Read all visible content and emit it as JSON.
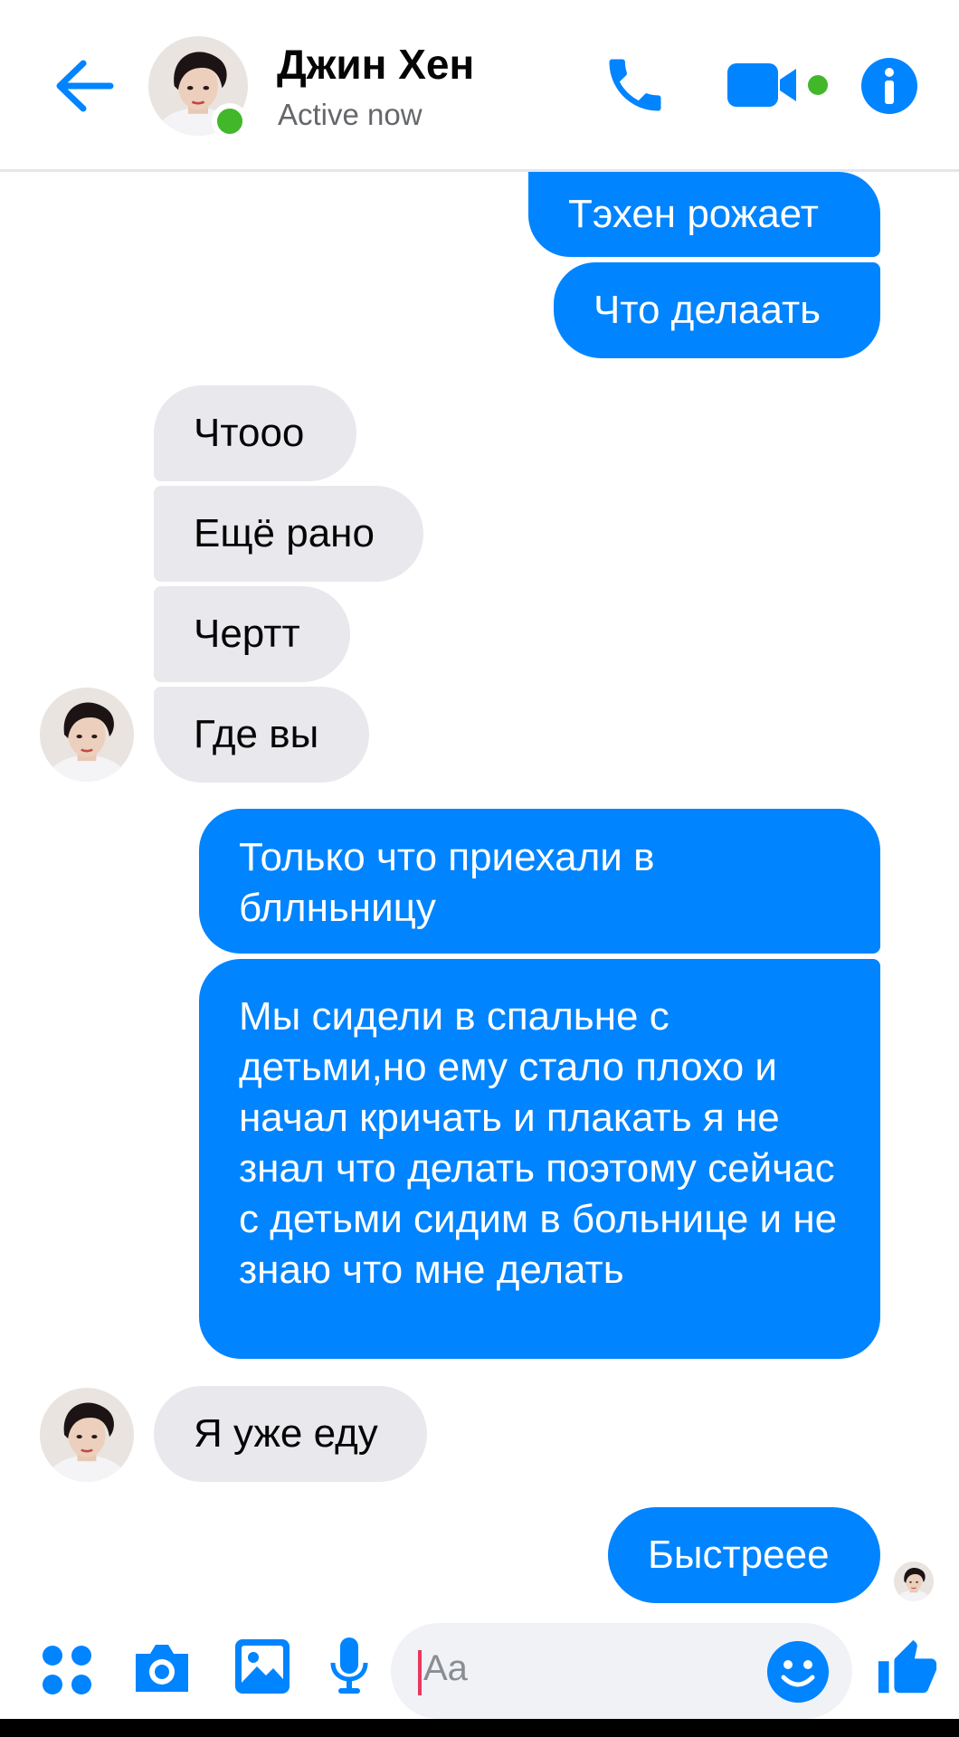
{
  "header": {
    "contact_name": "Джин Хен",
    "status": "Active now"
  },
  "messages": [
    {
      "side": "out",
      "text": "Тэхен рожает"
    },
    {
      "side": "out",
      "text": "Что делаать"
    },
    {
      "side": "in",
      "text": "Чтооо"
    },
    {
      "side": "in",
      "text": "Ещё рано"
    },
    {
      "side": "in",
      "text": "Чертт"
    },
    {
      "side": "in",
      "text": "Где вы"
    },
    {
      "side": "out",
      "text": "Только что приехали в бллньницу"
    },
    {
      "side": "out",
      "text": "Мы сидели в спальне с детьми,но ему стало плохо и начал кричать и плакать я не знал что делать поэтому сейчас с детьми сидим в больнице и не знаю что мне делать"
    },
    {
      "side": "in",
      "text": "Я уже еду"
    },
    {
      "side": "out",
      "text": "Быстреее"
    }
  ],
  "composer": {
    "placeholder": "Aa"
  },
  "colors": {
    "accent": "#0084ff",
    "incoming_bubble": "#e9e8ed",
    "online": "#42b72a"
  },
  "icons": [
    "back-arrow-icon",
    "phone-icon",
    "video-camera-icon",
    "info-icon",
    "apps-icon",
    "camera-icon",
    "gallery-icon",
    "microphone-icon",
    "emoji-icon",
    "thumbs-up-icon"
  ]
}
